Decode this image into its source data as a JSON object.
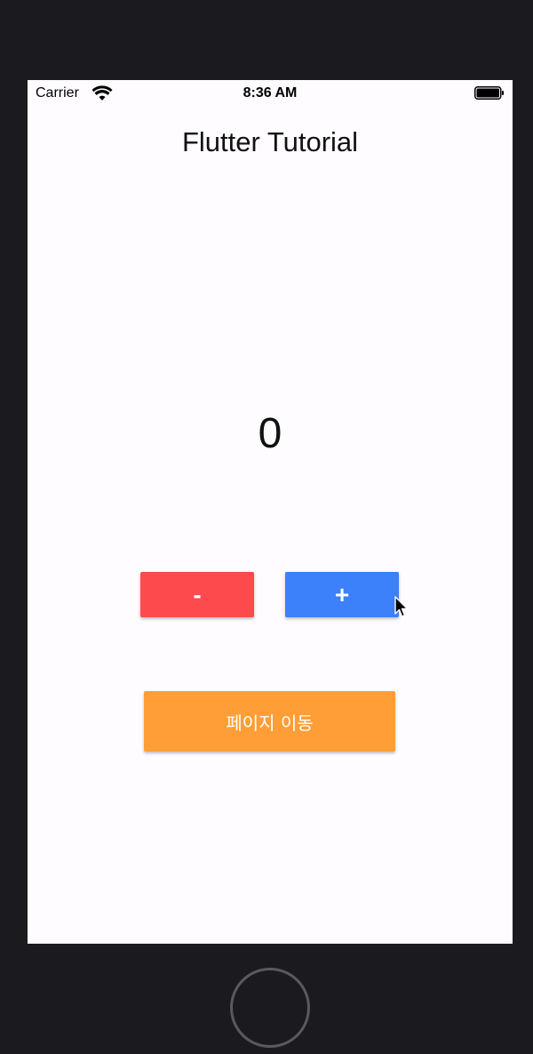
{
  "status_bar": {
    "carrier": "Carrier",
    "time": "8:36 AM",
    "icons": [
      "wifi-icon",
      "battery-icon"
    ]
  },
  "app": {
    "title": "Flutter Tutorial",
    "counter": "0"
  },
  "buttons": {
    "minus_label": "-",
    "plus_label": "+",
    "nav_label": "페이지 이동"
  },
  "colors": {
    "minus": "#fc4a4d",
    "plus": "#3c80fa",
    "nav": "#ff9e36",
    "background": "#fefcff",
    "device_frame": "#1b1a1e"
  }
}
